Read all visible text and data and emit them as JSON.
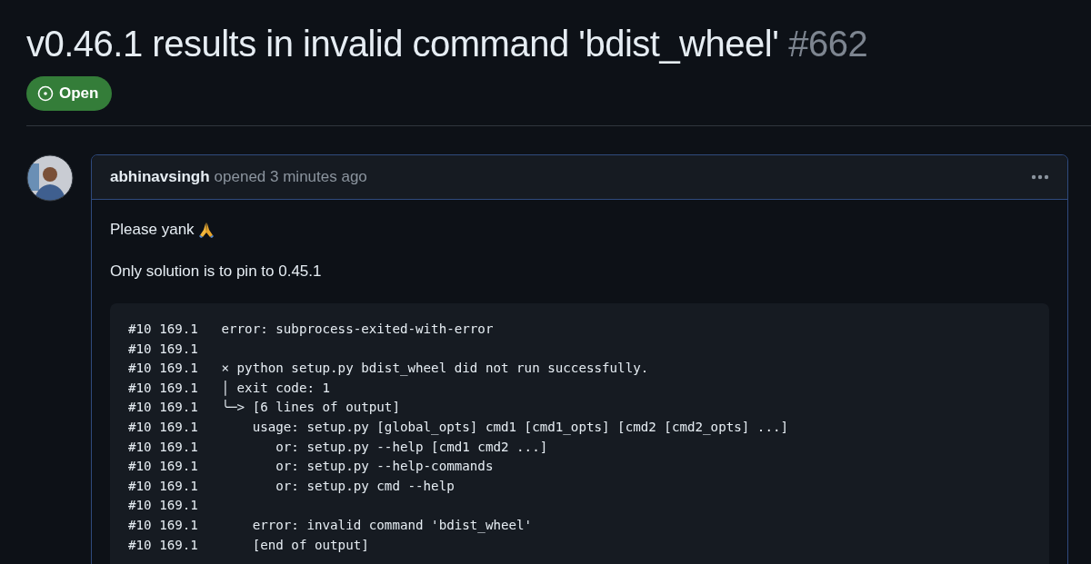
{
  "issue": {
    "title": "v0.46.1 results in invalid command 'bdist_wheel'",
    "number": "#662",
    "open": true,
    "state_label": "Open"
  },
  "comment": {
    "author": "abhinavsingh",
    "meta": "opened 3 minutes ago",
    "paragraphs": [
      {
        "kind": "emoji",
        "text": "Please yank"
      },
      {
        "kind": "plain",
        "text": "Only solution is to pin to 0.45.1"
      }
    ],
    "code_lines": [
      "#10 169.1   error: subprocess-exited-with-error",
      "#10 169.1",
      "#10 169.1   × python setup.py bdist_wheel did not run successfully.",
      "#10 169.1   │ exit code: 1",
      "#10 169.1   ╰─> [6 lines of output]",
      "#10 169.1       usage: setup.py [global_opts] cmd1 [cmd1_opts] [cmd2 [cmd2_opts] ...]",
      "#10 169.1          or: setup.py --help [cmd1 cmd2 ...]",
      "#10 169.1          or: setup.py --help-commands",
      "#10 169.1          or: setup.py cmd --help",
      "#10 169.1",
      "#10 169.1       error: invalid command 'bdist_wheel'",
      "#10 169.1       [end of output]"
    ]
  }
}
